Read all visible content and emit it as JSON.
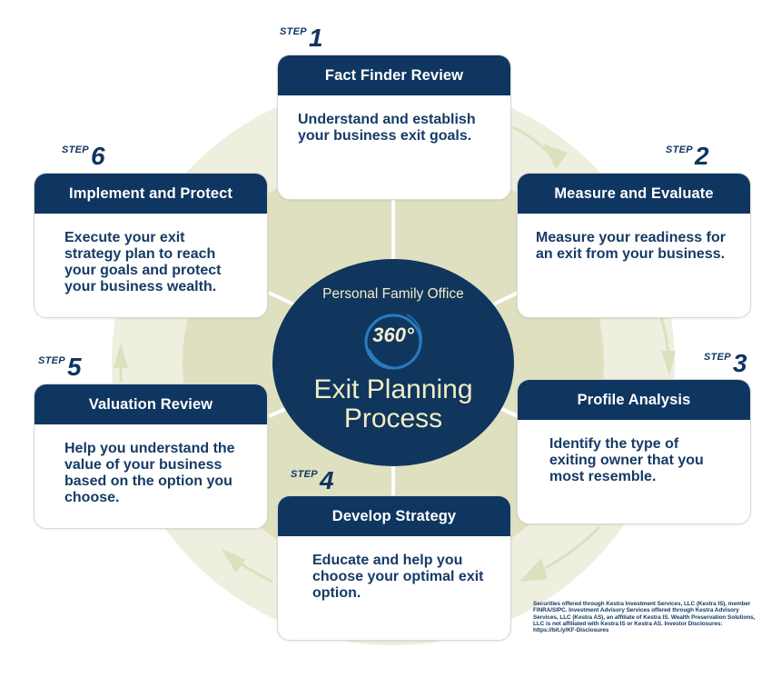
{
  "colors": {
    "navy": "#0f3660",
    "text_navy": "#163b66",
    "cream": "#f2ecc4",
    "ring_blue": "#2a7bbf",
    "outer_ring": "#eeefdf",
    "inner_disk": "#dfe0c0",
    "arrow": "#dde0bd"
  },
  "center": {
    "subtitle": "Personal Family Office",
    "degrees": "360°",
    "title_line1": "Exit Planning",
    "title_line2": "Process"
  },
  "steps": [
    {
      "step_word": "STEP",
      "number": "1",
      "title": "Fact Finder Review",
      "description": "Understand and establish your business exit goals."
    },
    {
      "step_word": "STEP",
      "number": "2",
      "title": "Measure and Evaluate",
      "description": "Measure your readiness for an exit from your business."
    },
    {
      "step_word": "STEP",
      "number": "3",
      "title": "Profile Analysis",
      "description": "Identify the type of exiting owner that you most resemble."
    },
    {
      "step_word": "STEP",
      "number": "4",
      "title": "Develop Strategy",
      "description": "Educate and help you choose your optimal exit option."
    },
    {
      "step_word": "STEP",
      "number": "5",
      "title": "Valuation Review",
      "description": "Help you understand the value of your business based on the option you choose."
    },
    {
      "step_word": "STEP",
      "number": "6",
      "title": "Implement and Protect",
      "description": "Execute your exit strategy plan to reach your goals and protect your business wealth."
    }
  ],
  "disclaimer": "Securities offered through Kestra Investment Services, LLC (Kestra IS), member FINRA/SIPC. Investment Advisory Services offered through Kestra Advisory Services, LLC (Kestra AS), an affiliate of Kestra IS. Wealth Preservation Solutions, LLC is not affiliated with Kestra IS or Kestra AS. Investor Disclosures: https://bit.ly/KF-Disclosures"
}
